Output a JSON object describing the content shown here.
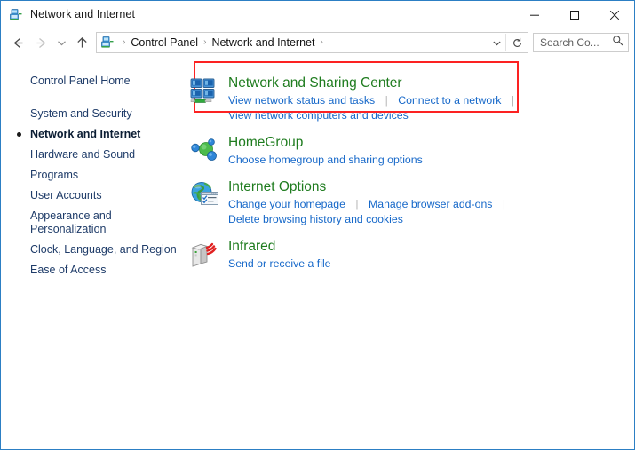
{
  "window": {
    "title": "Network and Internet",
    "title_icon": "network-folder-icon",
    "controls": {
      "minimize": "minimize-icon",
      "maximize": "maximize-icon",
      "close": "close-icon"
    }
  },
  "navbar": {
    "back": "back-arrow-icon",
    "forward": "forward-arrow-icon",
    "recent": "recent-locations-chevron-icon",
    "up": "up-arrow-icon",
    "breadcrumb_icon": "control-panel-icon",
    "breadcrumbs": [
      "Control Panel",
      "Network and Internet"
    ],
    "separator": "›",
    "dropdown": "chevron-down-icon",
    "refresh": "refresh-icon",
    "search": {
      "placeholder": "Search Co...",
      "value": "Search Co...",
      "icon": "search-icon"
    }
  },
  "sidebar": {
    "home": "Control Panel Home",
    "items": [
      {
        "label": "System and Security",
        "current": false
      },
      {
        "label": "Network and Internet",
        "current": true
      },
      {
        "label": "Hardware and Sound",
        "current": false
      },
      {
        "label": "Programs",
        "current": false
      },
      {
        "label": "User Accounts",
        "current": false
      },
      {
        "label": "Appearance and\nPersonalization",
        "current": false
      },
      {
        "label": "Clock, Language, and Region",
        "current": false
      },
      {
        "label": "Ease of Access",
        "current": false
      }
    ]
  },
  "main": {
    "categories": [
      {
        "title": "Network and Sharing Center",
        "icon": "network-sharing-center-icon",
        "highlighted": true,
        "links_row1": [
          "View network status and tasks",
          "Connect to a network"
        ],
        "trailing_separator_row1": true,
        "links_row2": [
          "View network computers and devices"
        ]
      },
      {
        "title": "HomeGroup",
        "icon": "homegroup-icon",
        "highlighted": false,
        "links_row1": [
          "Choose homegroup and sharing options"
        ],
        "trailing_separator_row1": false,
        "links_row2": []
      },
      {
        "title": "Internet Options",
        "icon": "internet-options-icon",
        "highlighted": false,
        "links_row1": [
          "Change your homepage",
          "Manage browser add-ons"
        ],
        "trailing_separator_row1": true,
        "links_row2": [
          "Delete browsing history and cookies"
        ]
      },
      {
        "title": "Infrared",
        "icon": "infrared-icon",
        "highlighted": false,
        "links_row1": [
          "Send or receive a file"
        ],
        "trailing_separator_row1": false,
        "links_row2": []
      }
    ]
  },
  "colors": {
    "window_border": "#2c7fc4",
    "category_title": "#1f7c1f",
    "link": "#1668c9",
    "sidebar_link": "#1f3c69",
    "highlight_box": "#fc2222"
  }
}
